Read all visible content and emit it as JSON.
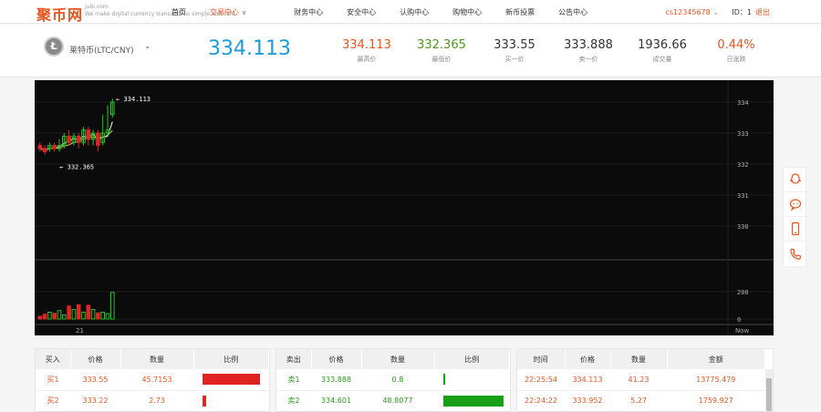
{
  "header": {
    "logo": "聚币网",
    "logo_domain": "jubi.com",
    "logo_tagline": "We make digital currency transactions simple and safe",
    "nav": [
      "首页",
      "交易中心",
      "财务中心",
      "安全中心",
      "认购中心",
      "购物中心",
      "新币投票",
      "公告中心"
    ],
    "nav_active": 1,
    "username": "cs12345678",
    "id_label": "ID：1",
    "logout": "退出"
  },
  "ticker": {
    "coin_symbol": "Ł",
    "coin_name": "莱特币(LTC/CNY)",
    "last_price": "334.113",
    "stats": [
      {
        "value": "334.113",
        "label": "最高价",
        "color": "#e8541e"
      },
      {
        "value": "332.365",
        "label": "最低价",
        "color": "#4a9a1a"
      },
      {
        "value": "333.55",
        "label": "买一价",
        "color": "#333333"
      },
      {
        "value": "333.888",
        "label": "卖一价",
        "color": "#333333"
      },
      {
        "value": "1936.66",
        "label": "成交量",
        "color": "#333333"
      },
      {
        "value": "0.44%",
        "label": "日涨跌",
        "color": "#e8541e"
      }
    ]
  },
  "chart_data": {
    "type": "candlestick",
    "price_axis": [
      "334",
      "333",
      "332",
      "331",
      "330"
    ],
    "volume_axis": [
      "200",
      "0"
    ],
    "x_labels": [
      "21",
      "Now"
    ],
    "high_marker": "← 334.113",
    "low_marker": "← 332.365",
    "candles": [
      {
        "o": 332.6,
        "c": 332.5,
        "h": 332.7,
        "l": 332.4
      },
      {
        "o": 332.5,
        "c": 332.4,
        "h": 332.6,
        "l": 332.3
      },
      {
        "o": 332.5,
        "c": 332.6,
        "h": 332.7,
        "l": 332.4
      },
      {
        "o": 332.6,
        "c": 332.5,
        "h": 332.7,
        "l": 332.4
      },
      {
        "o": 332.5,
        "c": 332.6,
        "h": 332.8,
        "l": 332.4
      },
      {
        "o": 332.6,
        "c": 332.9,
        "h": 333.0,
        "l": 332.5
      },
      {
        "o": 332.9,
        "c": 332.7,
        "h": 333.1,
        "l": 332.6
      },
      {
        "o": 332.7,
        "c": 332.9,
        "h": 333.0,
        "l": 332.6
      },
      {
        "o": 332.9,
        "c": 332.7,
        "h": 333.0,
        "l": 332.5
      },
      {
        "o": 332.7,
        "c": 333.1,
        "h": 333.2,
        "l": 332.6
      },
      {
        "o": 333.1,
        "c": 332.8,
        "h": 333.2,
        "l": 332.6
      },
      {
        "o": 332.8,
        "c": 333.0,
        "h": 333.1,
        "l": 332.6
      },
      {
        "o": 333.0,
        "c": 332.6,
        "h": 333.1,
        "l": 332.4
      },
      {
        "o": 332.7,
        "c": 333.0,
        "h": 333.6,
        "l": 332.6
      },
      {
        "o": 333.0,
        "c": 333.1,
        "h": 333.9,
        "l": 332.9
      },
      {
        "o": 333.6,
        "c": 334.0,
        "h": 334.113,
        "l": 333.5
      }
    ],
    "volumes": [
      20,
      35,
      50,
      42,
      62,
      30,
      95,
      70,
      105,
      50,
      100,
      70,
      45,
      50,
      40,
      195
    ],
    "volume_up": [
      false,
      false,
      true,
      false,
      true,
      true,
      false,
      true,
      false,
      true,
      false,
      true,
      false,
      true,
      true,
      true
    ]
  },
  "buy_table": {
    "headers": [
      "买入",
      "价格",
      "数量",
      "比例"
    ],
    "rows": [
      {
        "side": "买1",
        "price": "333.55",
        "amount": "45.7153",
        "ratio": 0.95
      },
      {
        "side": "买2",
        "price": "333.22",
        "amount": "2.73",
        "ratio": 0.06
      }
    ]
  },
  "sell_table": {
    "headers": [
      "卖出",
      "价格",
      "数量",
      "比例"
    ],
    "rows": [
      {
        "side": "卖1",
        "price": "333.888",
        "amount": "0.8",
        "ratio": 0.02
      },
      {
        "side": "卖2",
        "price": "334.601",
        "amount": "48.8077",
        "ratio": 1.0
      }
    ]
  },
  "trade_table": {
    "headers": [
      "时间",
      "价格",
      "数量",
      "金额"
    ],
    "rows": [
      {
        "time": "22:25:54",
        "price": "334.113",
        "amount": "41.23",
        "total": "13775.479"
      },
      {
        "time": "22:24:22",
        "price": "333.952",
        "amount": "5.27",
        "total": "1759.927"
      }
    ]
  }
}
